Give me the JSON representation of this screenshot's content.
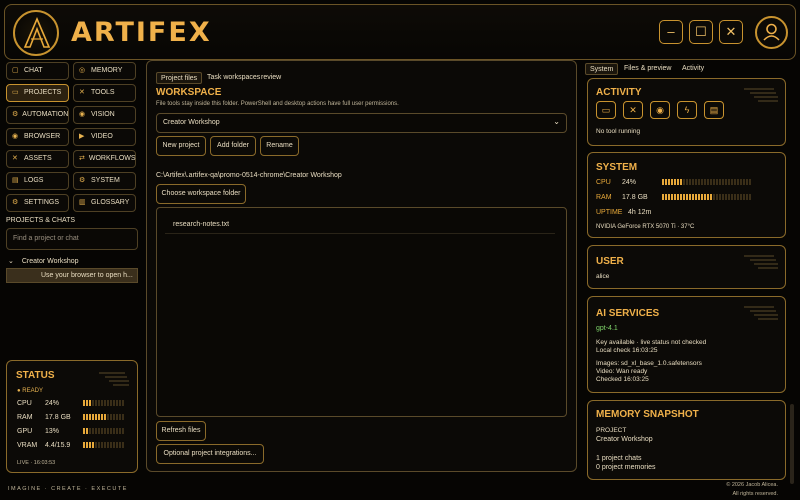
{
  "header": {
    "logo_text": "ARTIFEX",
    "logo_emblem_text": "ARTIFEX",
    "window_buttons": [
      "–",
      "☐",
      "✕"
    ]
  },
  "nav": [
    {
      "label": "CHAT",
      "icon": "chat-icon",
      "glyph": "▢"
    },
    {
      "label": "MEMORY",
      "icon": "brain-icon",
      "glyph": "◎"
    },
    {
      "label": "PROJECTS",
      "icon": "folder-icon",
      "glyph": "▭",
      "active": true
    },
    {
      "label": "TOOLS",
      "icon": "tools-icon",
      "glyph": "✕"
    },
    {
      "label": "AUTOMATION",
      "icon": "automation-icon",
      "glyph": "⚙"
    },
    {
      "label": "VISION",
      "icon": "eye-icon",
      "glyph": "◉"
    },
    {
      "label": "BROWSER",
      "icon": "browser-icon",
      "glyph": "◉"
    },
    {
      "label": "VIDEO",
      "icon": "video-icon",
      "glyph": "▶"
    },
    {
      "label": "ASSETS",
      "icon": "assets-icon",
      "glyph": "✕"
    },
    {
      "label": "WORKFLOWS",
      "icon": "workflow-icon",
      "glyph": "⇄"
    },
    {
      "label": "LOGS",
      "icon": "logs-icon",
      "glyph": "▤"
    },
    {
      "label": "SYSTEM",
      "icon": "system-icon",
      "glyph": "⚙"
    },
    {
      "label": "SETTINGS",
      "icon": "settings-icon",
      "glyph": "⚙"
    },
    {
      "label": "GLOSSARY",
      "icon": "book-icon",
      "glyph": "▥"
    }
  ],
  "projects_chats": {
    "title": "PROJECTS & CHATS",
    "search_placeholder": "Find a project or chat",
    "tree_project": "Creator Workshop",
    "chat_item": "Use your browser to open h..."
  },
  "status": {
    "title": "STATUS",
    "state": "READY",
    "rows": [
      {
        "label": "CPU",
        "value": "24%",
        "level": 0.24
      },
      {
        "label": "RAM",
        "value": "17.8 GB",
        "level": 0.6
      },
      {
        "label": "GPU",
        "value": "13%",
        "level": 0.13
      },
      {
        "label": "VRAM",
        "value": "4.4/15.9",
        "level": 0.28
      }
    ],
    "live": "LIVE · 16:03:53"
  },
  "center": {
    "tabs": [
      "Project files",
      "Task workspaces",
      "review"
    ],
    "title": "WORKSPACE",
    "note": "File tools stay inside this folder. PowerShell and desktop actions have full user permissions.",
    "selected_project": "Creator Workshop",
    "buttons": {
      "new_project": "New project",
      "add_folder": "Add folder",
      "rename": "Rename"
    },
    "path": "C:\\Artifex\\.artifex-qa\\promo-0514-chrome\\Creator Workshop",
    "choose_folder": "Choose workspace folder",
    "files": [
      "research-notes.txt"
    ],
    "refresh": "Refresh files",
    "integrations": "Optional project integrations..."
  },
  "right": {
    "tabs": [
      "System",
      "Files & preview",
      "Activity"
    ],
    "activity": {
      "title": "ACTIVITY",
      "status": "No tool running",
      "icons": [
        "folder-icon",
        "tools-icon",
        "eye-icon",
        "bolt-icon",
        "clipboard-icon"
      ]
    },
    "system": {
      "title": "SYSTEM",
      "cpu_label": "CPU",
      "cpu_value": "24%",
      "cpu_level": 0.24,
      "ram_label": "RAM",
      "ram_value": "17.8 GB",
      "ram_level": 0.56,
      "uptime_label": "UPTIME",
      "uptime_value": "4h 12m",
      "gpu": "NVIDIA GeForce RTX 5070 Ti · 37°C"
    },
    "user": {
      "title": "USER",
      "name": "alice"
    },
    "ai": {
      "title": "AI SERVICES",
      "model": "gpt-4.1",
      "line1": "Key available · live status not checked",
      "line2": "Local check 16:03:25",
      "line3": "Images: sd_xl_base_1.0.safetensors",
      "line4": "Video: Wan ready",
      "line5": "Checked 16:03:25"
    },
    "memory": {
      "title": "MEMORY SNAPSHOT",
      "project_label": "PROJECT",
      "project_name": "Creator Workshop",
      "chats": "1 project chats",
      "memories": "0 project memories"
    }
  },
  "footer": {
    "tagline": "IMAGINE · CREATE · EXECUTE",
    "copyright": "© 2026 Jacob Alicea.",
    "rights": "All rights reserved."
  },
  "colors": {
    "accent": "#e8a93a",
    "background": "#060503",
    "border": "#8a6a2a",
    "active_nav": "#2c2110"
  }
}
